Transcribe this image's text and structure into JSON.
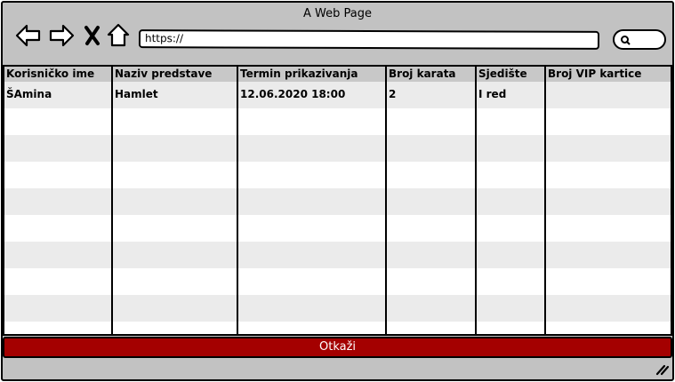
{
  "window": {
    "title": "A Web Page",
    "url": "https://"
  },
  "table": {
    "columns": [
      "Korisničko ime",
      "Naziv predstave",
      "Termin prikazivanja",
      "Broj karata",
      "Sjedište",
      "Broj VIP kartice"
    ],
    "rows": [
      [
        "ŠAmina",
        "Hamlet",
        "12.06.2020 18:00",
        "2",
        "I red",
        ""
      ]
    ],
    "row_stripe_color": "#ebebeb",
    "header_color": "#c8c8c8"
  },
  "actions": {
    "cancel_label": "Otkaži",
    "cancel_color": "#a40000"
  }
}
